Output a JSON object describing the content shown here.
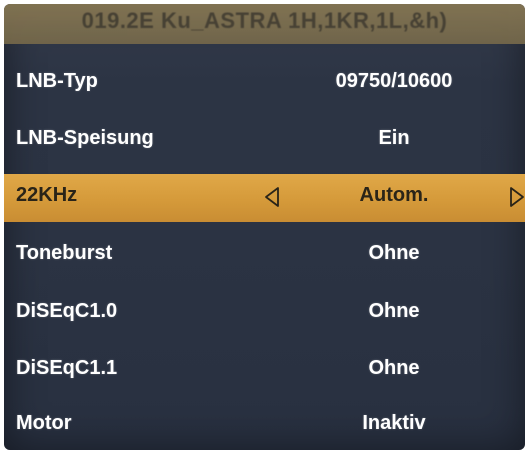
{
  "header": {
    "title": "019.2E Ku_ASTRA 1H,1KR,1L,&h)"
  },
  "menu": {
    "items": [
      {
        "label": "LNB-Typ",
        "value": "09750/10600",
        "selected": false
      },
      {
        "label": "LNB-Speisung",
        "value": "Ein",
        "selected": false
      },
      {
        "label": "22KHz",
        "value": "Autom.",
        "selected": true
      },
      {
        "label": "Toneburst",
        "value": "Ohne",
        "selected": false
      },
      {
        "label": "DiSEqC1.0",
        "value": "Ohne",
        "selected": false
      },
      {
        "label": "DiSEqC1.1",
        "value": "Ohne",
        "selected": false
      },
      {
        "label": "Motor",
        "value": "Inaktiv",
        "selected": false
      }
    ],
    "left_arrow_icon": "triangle-left-outline",
    "right_arrow_icon": "triangle-right-outline"
  },
  "colors": {
    "highlight": "#d99f3e",
    "background": "#2c3444",
    "text": "#ffffff",
    "header": "#8a7a55"
  }
}
